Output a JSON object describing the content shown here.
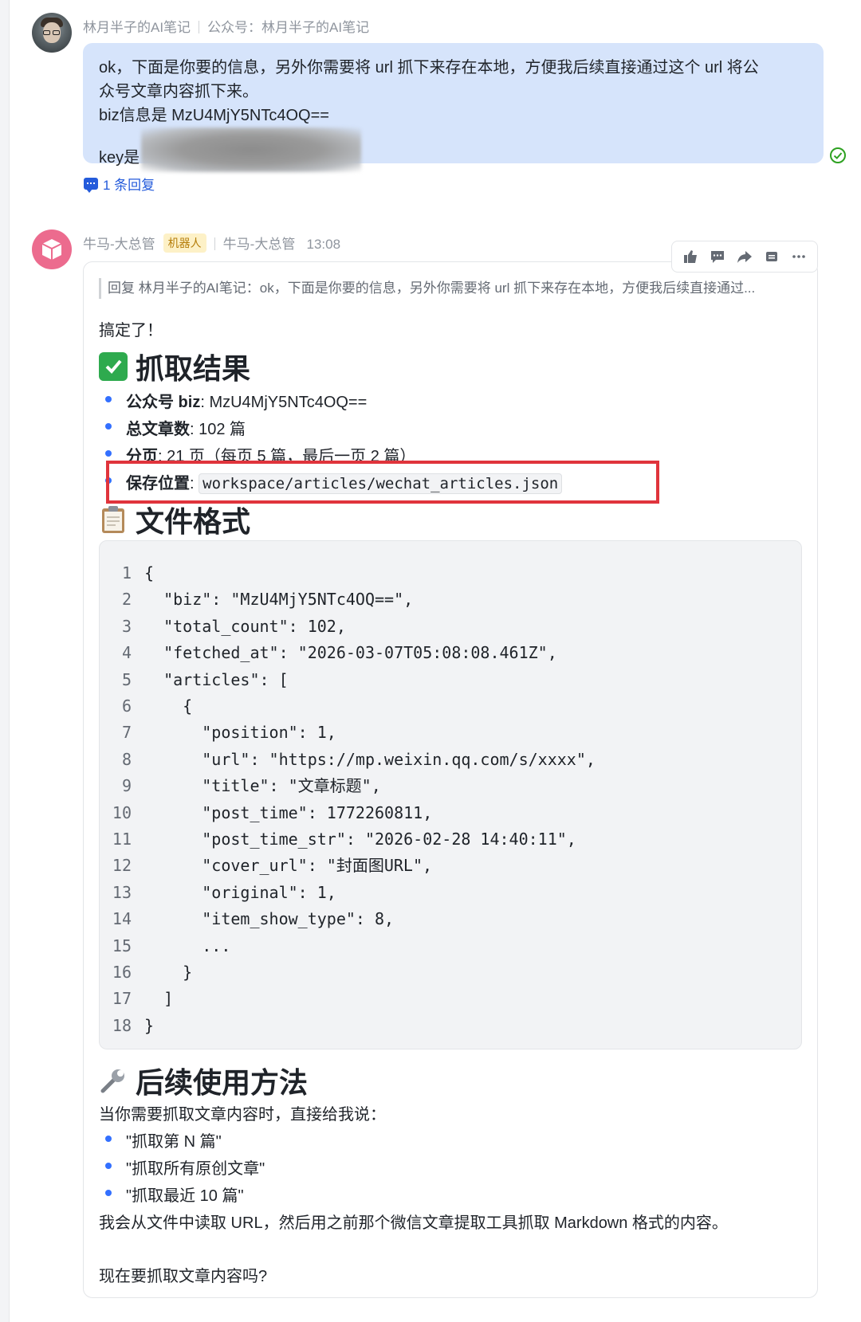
{
  "message1": {
    "sender": "林月半子的AI笔记",
    "source": "公众号：林月半子的AI笔记",
    "lines": [
      "ok，下面是你要的信息，另外你需要将 url 抓下来存在本地，方便我后续直接通过这个 url 将公",
      "众号文章内容抓下来。",
      "biz信息是 MzU4MjY5NTc4OQ==",
      "key是"
    ],
    "reply_count": "1 条回复"
  },
  "message2": {
    "sender": "牛马-大总管",
    "badge": "机器人",
    "sender2": "牛马-大总管",
    "time": "13:08",
    "quote": "回复 林月半子的AI笔记：ok，下面是你要的信息，另外你需要将 url 抓下来存在本地，方便我后续直接通过...",
    "intro": "搞定了！",
    "section1_title": "抓取结果",
    "results": [
      {
        "label": "公众号 biz",
        "value": ": MzU4MjY5NTc4OQ=="
      },
      {
        "label": "总文章数",
        "value": ": 102 篇"
      },
      {
        "label": "分页",
        "value": ": 21 页（每页 5 篇，最后一页 2 篇）"
      },
      {
        "label": "保存位置",
        "value": ": ",
        "code": "workspace/articles/wechat_articles.json"
      }
    ],
    "section2_title": "文件格式",
    "code_lines": [
      {
        "n": "1",
        "t": "{"
      },
      {
        "n": "2",
        "t": "  \"biz\": \"MzU4MjY5NTc4OQ==\","
      },
      {
        "n": "3",
        "t": "  \"total_count\": 102,"
      },
      {
        "n": "4",
        "t": "  \"fetched_at\": \"2026-03-07T05:08:08.461Z\","
      },
      {
        "n": "5",
        "t": "  \"articles\": ["
      },
      {
        "n": "6",
        "t": "    {"
      },
      {
        "n": "7",
        "t": "      \"position\": 1,"
      },
      {
        "n": "8",
        "t": "      \"url\": \"https://mp.weixin.qq.com/s/xxxx\","
      },
      {
        "n": "9",
        "t": "      \"title\": \"文章标题\","
      },
      {
        "n": "10",
        "t": "      \"post_time\": 1772260811,"
      },
      {
        "n": "11",
        "t": "      \"post_time_str\": \"2026-02-28 14:40:11\","
      },
      {
        "n": "12",
        "t": "      \"cover_url\": \"封面图URL\","
      },
      {
        "n": "13",
        "t": "      \"original\": 1,"
      },
      {
        "n": "14",
        "t": "      \"item_show_type\": 8,"
      },
      {
        "n": "15",
        "t": "      ..."
      },
      {
        "n": "16",
        "t": "    }"
      },
      {
        "n": "17",
        "t": "  ]"
      },
      {
        "n": "18",
        "t": "}"
      }
    ],
    "section3_title": "后续使用方法",
    "usage_intro": "当你需要抓取文章内容时，直接给我说：",
    "usage_items": [
      "\"抓取第 N 篇\"",
      "\"抓取所有原创文章\"",
      "\"抓取最近 10 篇\""
    ],
    "usage_note": "我会从文件中读取 URL，然后用之前那个微信文章提取工具抓取 Markdown 格式的内容。",
    "question": "现在要抓取文章内容吗?"
  },
  "colors": {
    "bubble_bg": "#d6e4fb",
    "link_blue": "#245bdb",
    "highlight_red": "#e0343c",
    "bot_badge_bg": "#fdf1c7",
    "bot_avatar": "#ec6b8e"
  },
  "icons": [
    "avatar",
    "bot-avatar",
    "comment-icon",
    "check-circle-icon",
    "thumbs-up-icon",
    "comment-bubble-icon",
    "forward-icon",
    "pin-icon",
    "more-icon",
    "check-mark-emoji-icon",
    "clipboard-emoji-icon",
    "wrench-emoji-icon"
  ]
}
